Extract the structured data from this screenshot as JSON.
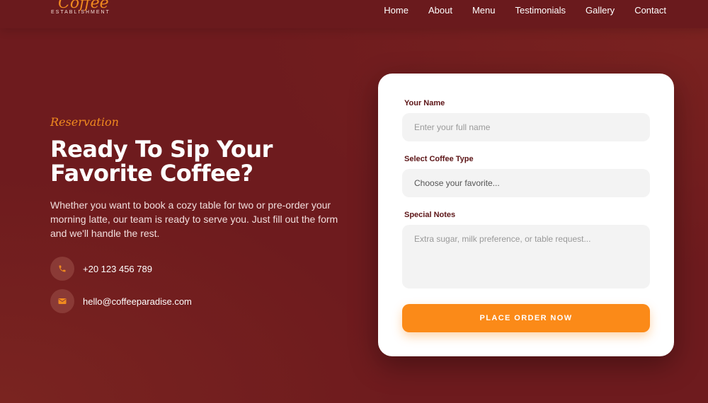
{
  "brand": {
    "name": "Coffee",
    "tagline": "ESTABLISHMENT"
  },
  "nav": {
    "items": [
      "Home",
      "About",
      "Menu",
      "Testimonials",
      "Gallery",
      "Contact"
    ]
  },
  "hero": {
    "eyebrow": "Reservation",
    "headline_line1": "Ready To Sip Your",
    "headline_line2": "Favorite Coffee?",
    "description": "Whether you want to book a cozy table for two or pre-order your morning latte, our team is ready to serve you. Just fill out the form and we'll handle the rest."
  },
  "contact": {
    "phone": "+20 123 456 789",
    "phone_icon": "phone-icon",
    "email": "hello@coffeeparadise.com",
    "email_icon": "envelope-icon"
  },
  "form": {
    "name_label": "Your Name",
    "name_placeholder": "Enter your full name",
    "coffee_label": "Select Coffee Type",
    "coffee_selected": "Choose your favorite...",
    "notes_label": "Special Notes",
    "notes_placeholder": "Extra sugar, milk preference, or table request...",
    "submit_label": "PLACE ORDER NOW"
  },
  "colors": {
    "background": "#6e1b1e",
    "accent": "#fb8a18",
    "label": "#5c1416",
    "card": "#ffffff"
  }
}
